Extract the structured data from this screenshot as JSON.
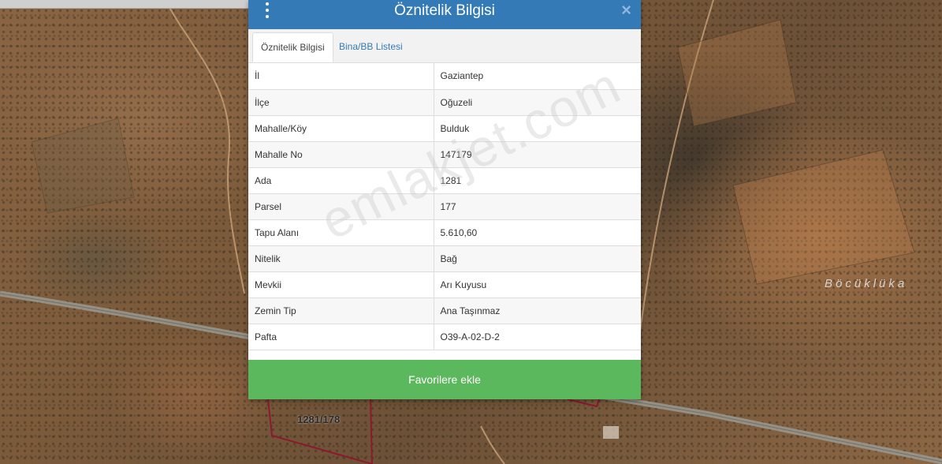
{
  "dialog": {
    "title": "Öznitelik Bilgisi",
    "close_symbol": "×",
    "menu_icon": "kebab-menu-icon",
    "tabs": [
      {
        "label": "Öznitelik Bilgisi",
        "active": true
      },
      {
        "label": "Bina/BB Listesi",
        "active": false
      }
    ],
    "rows": [
      {
        "key": "İl",
        "value": "Gaziantep"
      },
      {
        "key": "İlçe",
        "value": "Oğuzeli"
      },
      {
        "key": "Mahalle/Köy",
        "value": "Bulduk"
      },
      {
        "key": "Mahalle No",
        "value": "147179"
      },
      {
        "key": "Ada",
        "value": "1281"
      },
      {
        "key": "Parsel",
        "value": "177"
      },
      {
        "key": "Tapu Alanı",
        "value": "5.610,60"
      },
      {
        "key": "Nitelik",
        "value": "Bağ"
      },
      {
        "key": "Mevkii",
        "value": "Arı Kuyusu"
      },
      {
        "key": "Zemin Tip",
        "value": "Ana Taşınmaz"
      },
      {
        "key": "Pafta",
        "value": "O39-A-02-D-2"
      }
    ],
    "favorite_button_label": "Favorilere ekle"
  },
  "map": {
    "place_label": "Böcüklüka",
    "parcel_label": "1281/178",
    "parcel_border_color": "#8b1a2e"
  },
  "watermark": "emlakjet.com",
  "colors": {
    "header": "#337ab7",
    "button": "#5cb85c",
    "tab_link": "#337ab7"
  }
}
